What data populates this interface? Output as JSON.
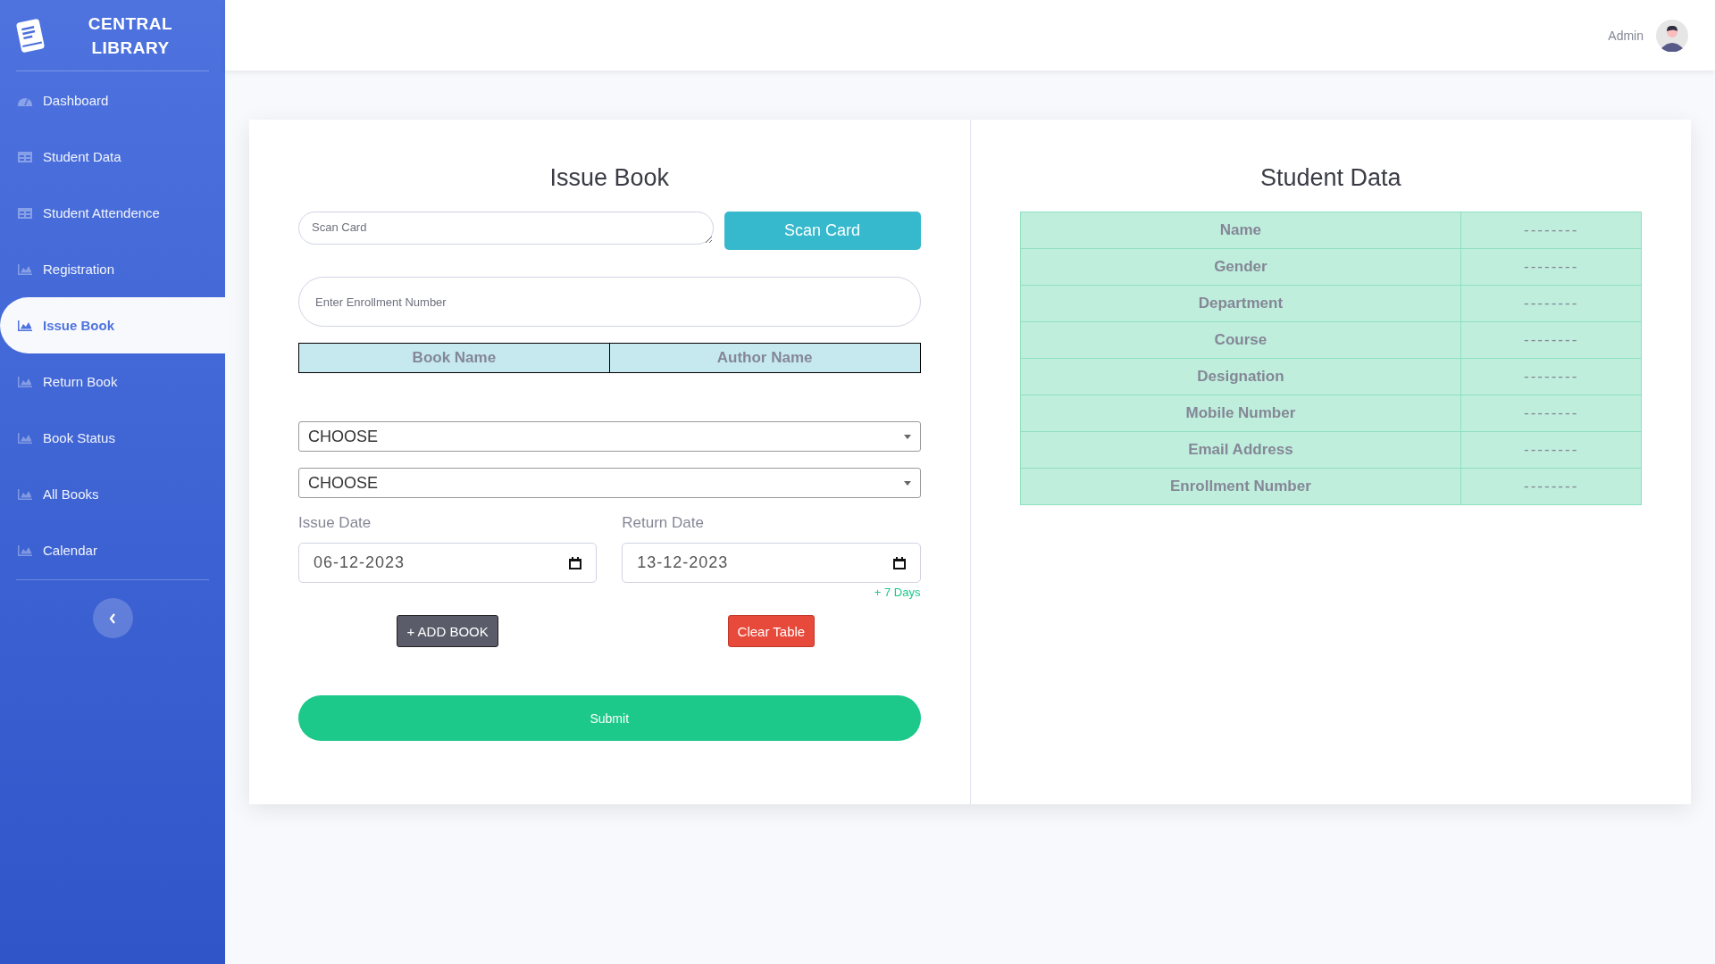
{
  "sidebar": {
    "brand": [
      "CENTRAL",
      "LIBRARY"
    ],
    "items": [
      {
        "label": "Dashboard",
        "kind": "gauge",
        "selected": false
      },
      {
        "label": "Student Data",
        "kind": "table",
        "selected": false
      },
      {
        "label": "Student Attendence",
        "kind": "table",
        "selected": false
      },
      {
        "label": "Registration",
        "kind": "chart",
        "selected": false
      },
      {
        "label": "Issue Book",
        "kind": "chart",
        "selected": true
      },
      {
        "label": "Return Book",
        "kind": "chart",
        "selected": false
      },
      {
        "label": "Book Status",
        "kind": "chart",
        "selected": false
      },
      {
        "label": "All Books",
        "kind": "chart",
        "selected": false
      },
      {
        "label": "Calendar",
        "kind": "chart",
        "selected": false
      }
    ]
  },
  "header": {
    "user": "Admin"
  },
  "issue_form": {
    "title": "Issue Book",
    "scan_field": {
      "placeholder": "Scan Card"
    },
    "scan_button": "Scan Card",
    "enrollment_field": {
      "placeholder": "Enter Enrollment Number"
    },
    "table": {
      "columns": [
        "Book Name",
        "Author Name"
      ]
    },
    "selects": [
      "CHOOSE",
      "CHOOSE"
    ],
    "issue_date": {
      "label": "Issue Date",
      "value": "06-12-2023"
    },
    "return_date": {
      "label": "Return Date",
      "value": "13-12-2023",
      "hint": "+ 7 Days"
    },
    "add_button": "+ ADD BOOK",
    "clear_button": "Clear Table",
    "submit_button": "Submit"
  },
  "student_data": {
    "title": "Student Data",
    "rows": [
      {
        "label": "Name",
        "value": "--------"
      },
      {
        "label": "Gender",
        "value": "--------"
      },
      {
        "label": "Department",
        "value": "--------"
      },
      {
        "label": "Course",
        "value": "--------"
      },
      {
        "label": "Designation",
        "value": "--------"
      },
      {
        "label": "Mobile Number",
        "value": "--------"
      },
      {
        "label": "Email Address",
        "value": "--------"
      },
      {
        "label": "Enrollment Number",
        "value": "--------"
      }
    ]
  }
}
